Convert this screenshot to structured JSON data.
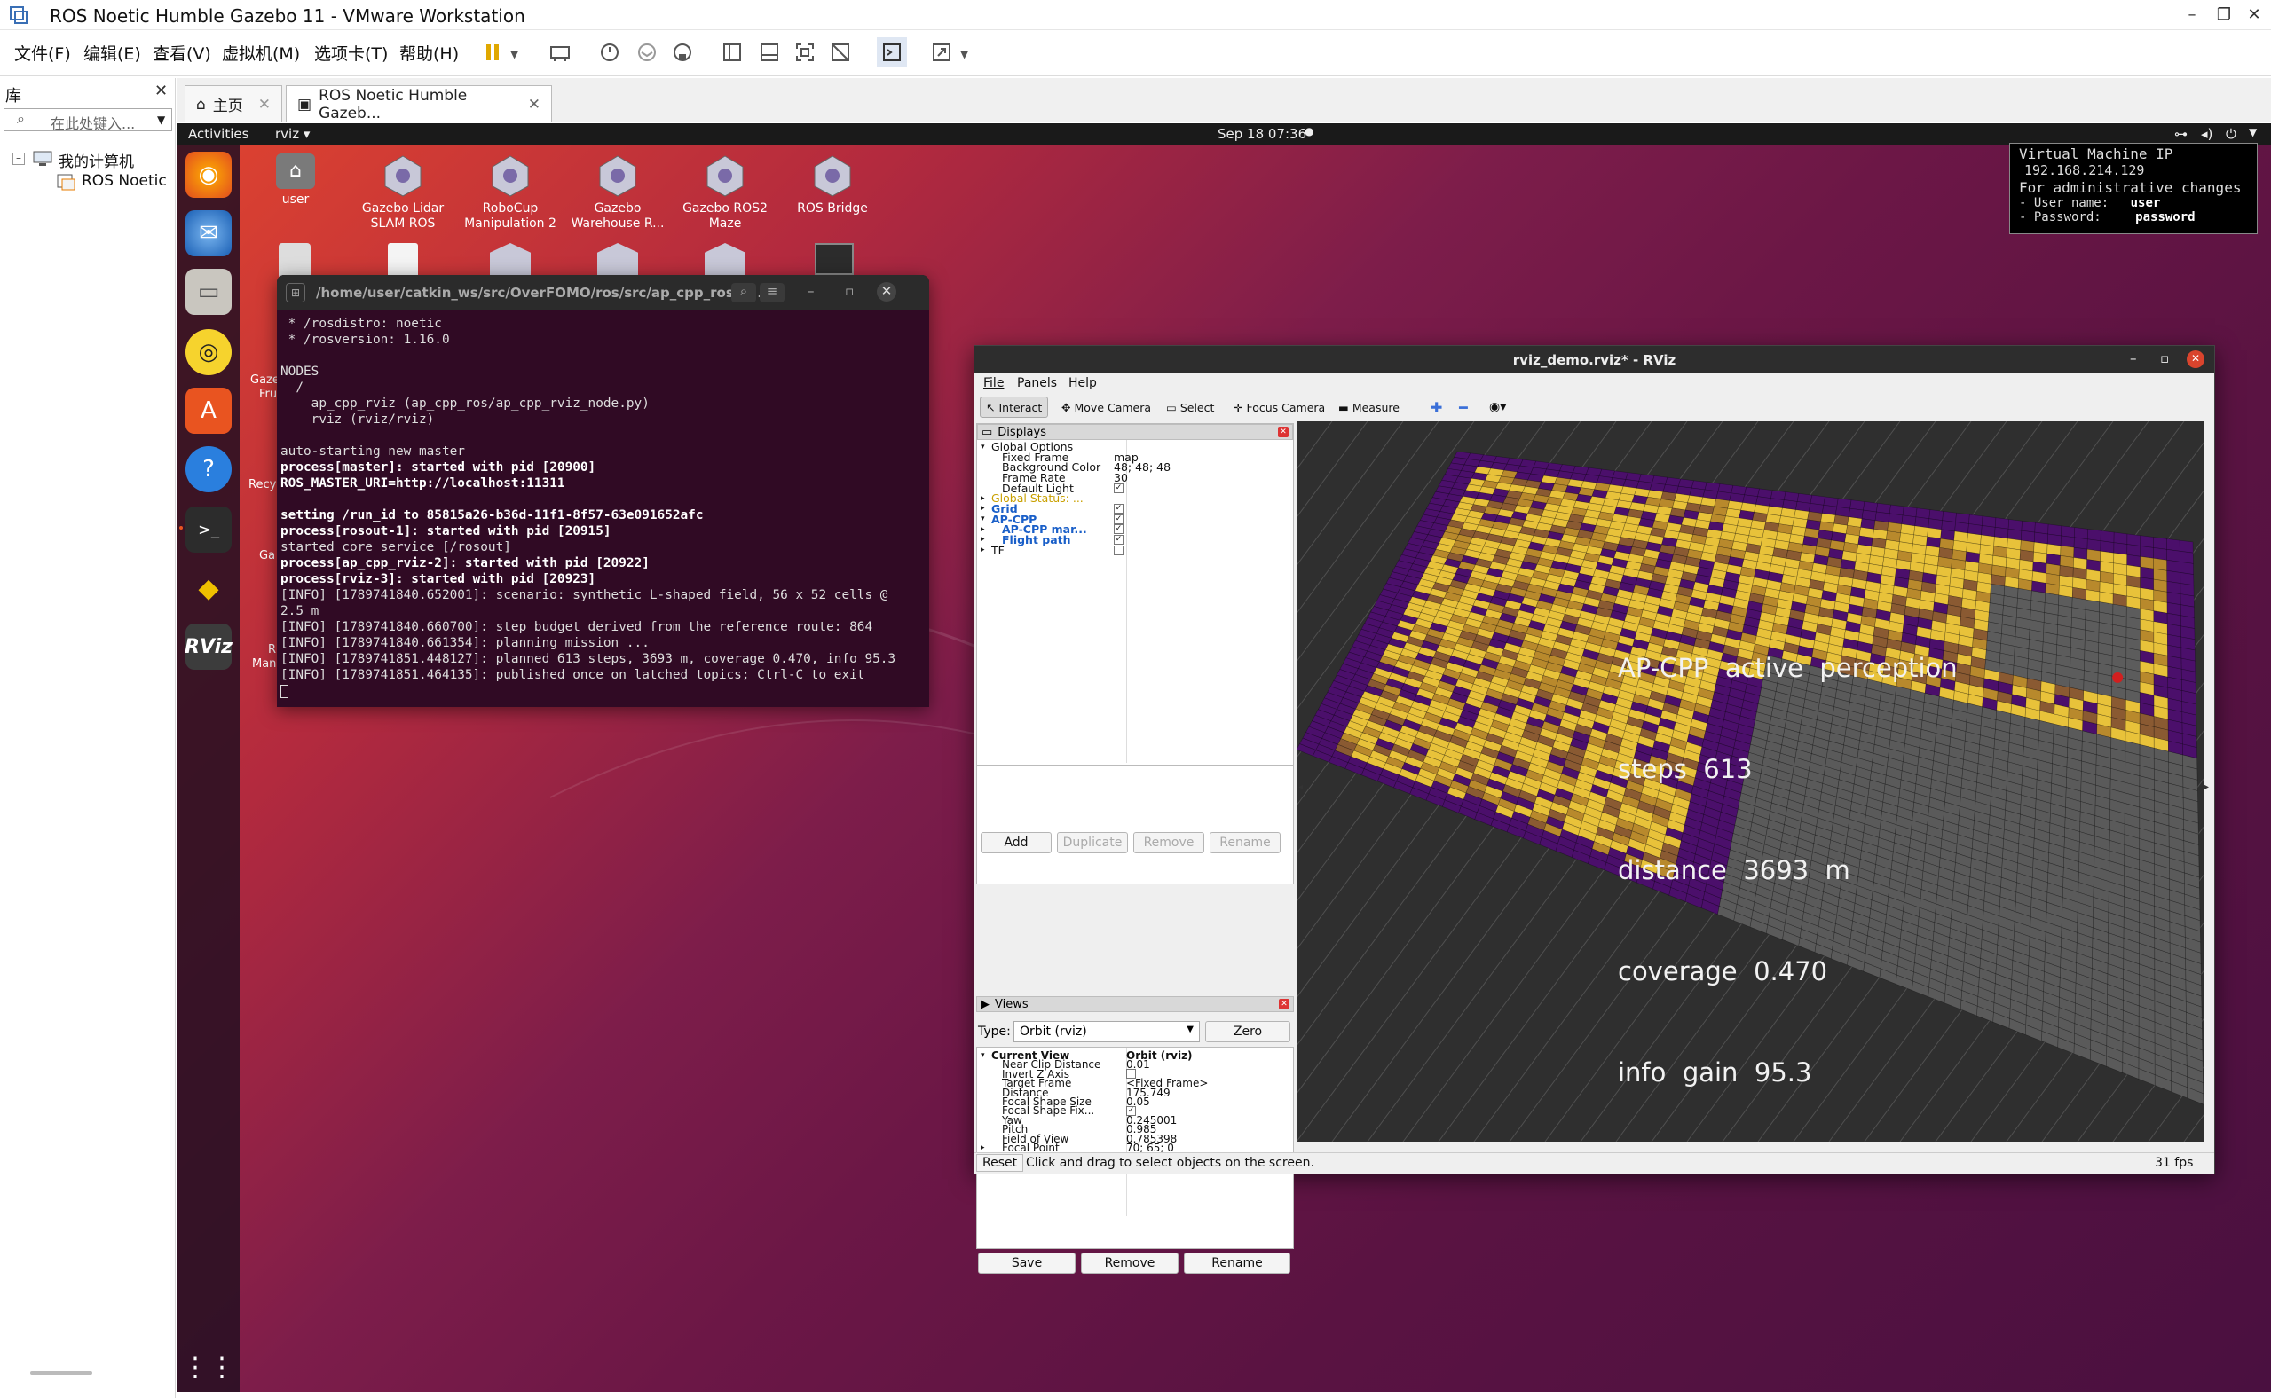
{
  "window": {
    "title": "ROS Noetic Humble Gazebo 11 - VMware Workstation"
  },
  "menubar": {
    "items": [
      "文件(F)",
      "编辑(E)",
      "查看(V)",
      "虚拟机(M)",
      "选项卡(T)",
      "帮助(H)"
    ]
  },
  "library": {
    "title": "库",
    "search_placeholder": "在此处键入...",
    "tree": [
      "我的计算机",
      "ROS Noetic"
    ]
  },
  "tabs": [
    {
      "label": "主页"
    },
    {
      "label": "ROS Noetic Humble Gazeb..."
    }
  ],
  "guest": {
    "topbar": {
      "activities": "Activities",
      "app": "rviz ▾",
      "clock": "Sep 18  07:36"
    },
    "desktop_icons": [
      "user",
      "Gazebo Lidar SLAM ROS",
      "RoboCup Manipulation 2",
      "Gazebo Warehouse R...",
      "Gazebo ROS2 Maze",
      "ROS Bridge"
    ],
    "desktop_partial_labels": [
      "Gaze",
      "Fru",
      "Recy",
      "Ga",
      "R",
      "Man"
    ],
    "vm_info": {
      "line1": "Virtual Machine IP",
      "ip": "192.168.214.129",
      "line3": "For administrative changes",
      "user_label": "- User name:",
      "user": "user",
      "pass_label": "- Password:",
      "password": "password"
    },
    "terminal": {
      "path": "/home/user/catkin_ws/src/OverFOMO/ros/src/ap_cpp_ros/la...",
      "lines": [
        " * /rosdistro: noetic",
        " * /rosversion: 1.16.0",
        "",
        "NODES",
        "  /",
        "    ap_cpp_rviz (ap_cpp_ros/ap_cpp_rviz_node.py)",
        "    rviz (rviz/rviz)",
        "",
        "auto-starting new master",
        "process[master]: started with pid [20900]",
        "ROS_MASTER_URI=http://localhost:11311",
        "",
        "setting /run_id to 85815a26-b36d-11f1-8f57-63e091652afc",
        "process[rosout-1]: started with pid [20915]",
        "started core service [/rosout]",
        "process[ap_cpp_rviz-2]: started with pid [20922]",
        "process[rviz-3]: started with pid [20923]",
        "[INFO] [1789741840.652001]: scenario: synthetic L-shaped field, 56 x 52 cells @",
        "2.5 m",
        "[INFO] [1789741840.660700]: step budget derived from the reference route: 864",
        "[INFO] [1789741840.661354]: planning mission ...",
        "[INFO] [1789741851.448127]: planned 613 steps, 3693 m, coverage 0.470, info 95.3",
        "[INFO] [1789741851.464135]: published once on latched topics; Ctrl-C to exit"
      ]
    },
    "rviz": {
      "title": "rviz_demo.rviz* - RViz",
      "menu": [
        "File",
        "Panels",
        "Help"
      ],
      "tools": [
        "Interact",
        "Move Camera",
        "Select",
        "Focus Camera",
        "Measure"
      ],
      "displays_title": "Displays",
      "displays": [
        {
          "name": "Global Options",
          "value": ""
        },
        {
          "name": "Fixed Frame",
          "value": "map"
        },
        {
          "name": "Background Color",
          "value": "48; 48; 48"
        },
        {
          "name": "Frame Rate",
          "value": "30"
        },
        {
          "name": "Default Light",
          "value": "✓"
        },
        {
          "name": "Global Status: ...",
          "value": ""
        },
        {
          "name": "Grid",
          "value": "✓"
        },
        {
          "name": "AP-CPP",
          "value": "✓"
        },
        {
          "name": "AP-CPP mar...",
          "value": "✓"
        },
        {
          "name": "Flight path",
          "value": "✓"
        },
        {
          "name": "TF",
          "value": ""
        }
      ],
      "display_buttons": [
        "Add",
        "Duplicate",
        "Remove",
        "Rename"
      ],
      "views_title": "Views",
      "views_type_label": "Type:",
      "views_type_value": "Orbit (rviz)",
      "views_zero": "Zero",
      "views": [
        {
          "name": "Current View",
          "value": "Orbit (rviz)"
        },
        {
          "name": "Near Clip Distance",
          "value": "0.01"
        },
        {
          "name": "Invert Z Axis",
          "value": ""
        },
        {
          "name": "Target Frame",
          "value": "<Fixed Frame>"
        },
        {
          "name": "Distance",
          "value": "175.749"
        },
        {
          "name": "Focal Shape Size",
          "value": "0.05"
        },
        {
          "name": "Focal Shape Fix...",
          "value": "✓"
        },
        {
          "name": "Yaw",
          "value": "0.245001"
        },
        {
          "name": "Pitch",
          "value": "0.985"
        },
        {
          "name": "Field of View",
          "value": "0.785398"
        },
        {
          "name": "Focal Point",
          "value": "70; 65; 0"
        }
      ],
      "view_buttons": [
        "Save",
        "Remove",
        "Rename"
      ],
      "overlay": [
        "AP-CPP  active  perception",
        "steps  613",
        "distance  3693  m",
        "coverage  0.470",
        "info  gain  95.3"
      ],
      "status": {
        "reset": "Reset",
        "hint": "Click and drag to select objects on the screen.",
        "fps": "31 fps"
      }
    }
  },
  "colors": {
    "ubuntu_orange": "#e95420",
    "unexplored": "#4b0f6b",
    "known_free": "#e8c23a",
    "path_dot": "#d21f1f"
  }
}
